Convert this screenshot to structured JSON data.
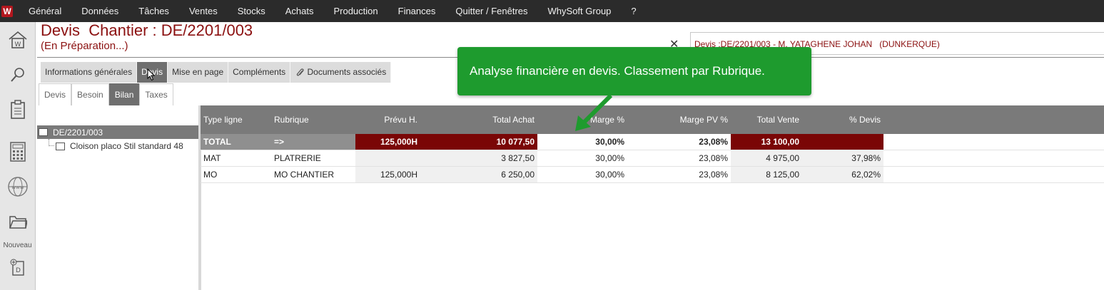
{
  "app": {
    "logo_letter": "W"
  },
  "menu": [
    "Général",
    "Données",
    "Tâches",
    "Ventes",
    "Stocks",
    "Achats",
    "Production",
    "Finances",
    "Quitter / Fenêtres",
    "WhySoft Group",
    "?"
  ],
  "sidebar": {
    "icons": [
      "home-icon",
      "search-icon",
      "clipboard-icon",
      "calculator-icon",
      "globe-icon",
      "folder-icon"
    ],
    "new_label": "Nouveau",
    "new_icon": "new-document-icon"
  },
  "header": {
    "title": "Devis  Chantier : DE/2201/003",
    "status": "(En Préparation...)",
    "search_value": "Devis :DE/2201/003 - M. YATAGHENE JOHAN   (DUNKERQUE)"
  },
  "tabs": [
    "Informations générales",
    "Devis",
    "Mise en page",
    "Compléments",
    "Documents associés"
  ],
  "active_tab": "Devis",
  "subtabs": [
    "Devis",
    "Besoin",
    "Bilan",
    "Taxes"
  ],
  "active_subtab": "Bilan",
  "tree": {
    "root": "DE/2201/003",
    "children": [
      "Cloison placo Stil standard 48"
    ]
  },
  "grid": {
    "headers": [
      "Type ligne",
      "Rubrique",
      "Prévu H.",
      "Total Achat",
      "Marge %",
      "Marge PV %",
      "Total Vente",
      "% Devis"
    ],
    "total_row": [
      "TOTAL",
      "=>",
      "125,000H",
      "10 077,50",
      "30,00%",
      "23,08%",
      "13 100,00",
      ""
    ],
    "rows": [
      [
        "MAT",
        "PLATRERIE",
        "",
        "3 827,50",
        "30,00%",
        "23,08%",
        "4 975,00",
        "37,98%"
      ],
      [
        "MO",
        "MO CHANTIER",
        "125,000H",
        "6 250,00",
        "30,00%",
        "23,08%",
        "8 125,00",
        "62,02%"
      ]
    ]
  },
  "tooltip": {
    "text": "Analyse financière en devis. Classement par Rubrique."
  },
  "colors": {
    "accent": "#8b1010",
    "tooltip": "#1e9b2e",
    "menubar": "#2b2b2b"
  }
}
